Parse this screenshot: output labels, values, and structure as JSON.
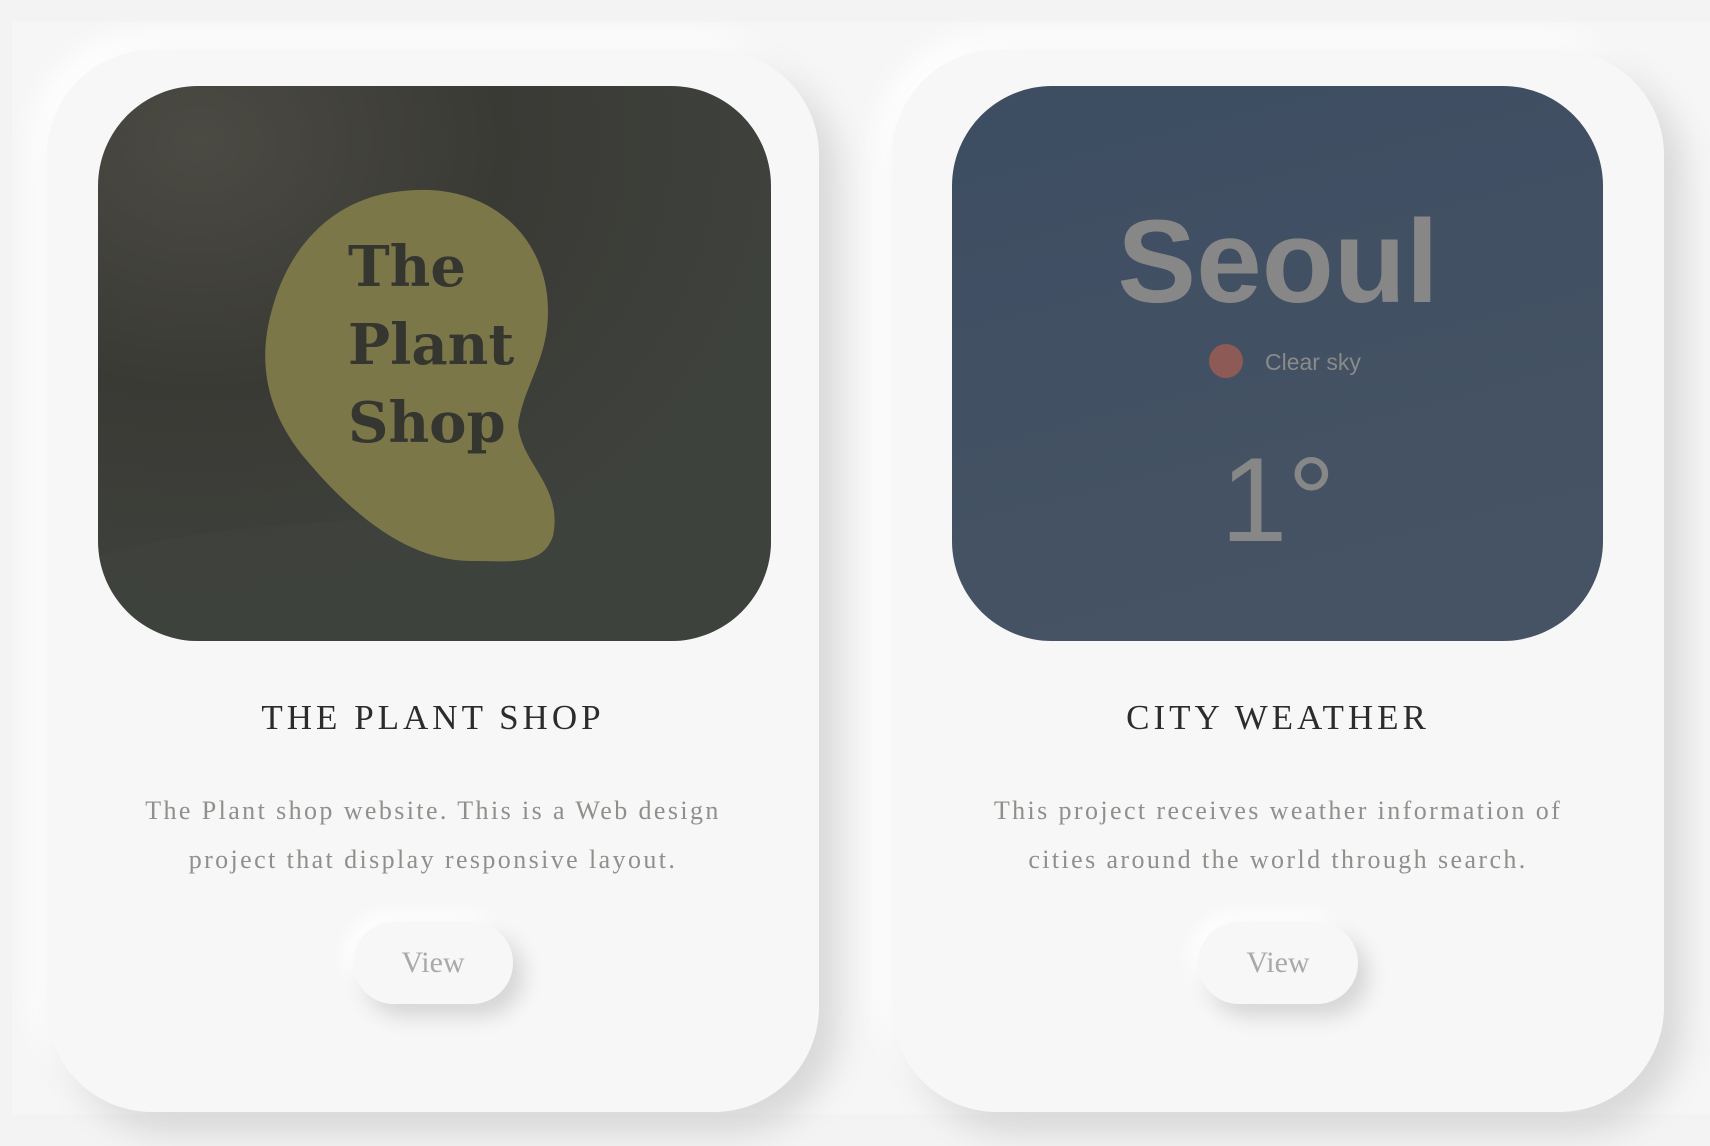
{
  "projects": [
    {
      "title": "THE PLANT SHOP",
      "description": "The Plant shop website. This is a Web design project that display responsive layout.",
      "view_label": "View",
      "thumbnail": {
        "logo_lines": [
          "The",
          "Plant",
          "Shop"
        ],
        "background_color": "#3d3d38",
        "blob_color": "#7b7749",
        "text_color": "#363631"
      }
    },
    {
      "title": "CITY WEATHER",
      "description": "This project receives weather information of cities around the world through search.",
      "view_label": "View",
      "thumbnail": {
        "city": "Seoul",
        "condition": "Clear sky",
        "temperature": "1°",
        "icon": "sun-icon",
        "background_color": "#40526a",
        "sun_color": "#8e5a55",
        "text_color": "#878787"
      }
    }
  ]
}
